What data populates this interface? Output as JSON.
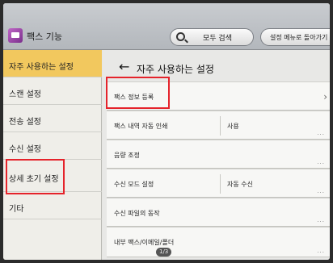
{
  "header": {
    "app_title": "팩스 기능",
    "search_label": "모두 검색",
    "menu_label": "설정 메뉴로 돌아가기"
  },
  "sidebar": {
    "items": [
      {
        "label": "자주 사용하는 설정",
        "active": true
      },
      {
        "label": "스캔 설정"
      },
      {
        "label": "전송 설정"
      },
      {
        "label": "수신 설정"
      },
      {
        "label": "상세 초기 설정"
      },
      {
        "label": "기타"
      }
    ]
  },
  "main": {
    "title": "자주 사용하는 설정",
    "rows": [
      {
        "label": "팩스 정보 등록"
      },
      {
        "label": "팩스 내역 자동 인쇄",
        "value": "사용"
      },
      {
        "label": "음량 조정"
      },
      {
        "label": "수신 모드 설정",
        "value": "자동 수신"
      },
      {
        "label": "수신 파일의 동작"
      },
      {
        "label": "내부 팩스/이메일/폴더"
      }
    ]
  },
  "badge": "1/3",
  "colors": {
    "active_item": "#f2c85e",
    "highlight": "#e5232b"
  }
}
